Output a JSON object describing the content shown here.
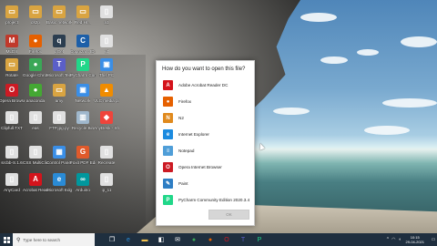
{
  "desktop": {
    "icons": [
      {
        "label": "project",
        "color": "#d9a441",
        "glyph": "▭"
      },
      {
        "label": "ds2p",
        "color": "#d9a441",
        "glyph": "▭"
      },
      {
        "label": "Basic network libr...",
        "color": "#d9a441",
        "glyph": "▭"
      },
      {
        "label": "Red Hr...",
        "color": "#d9a441",
        "glyph": "▭"
      },
      {
        "label": "a1",
        "color": "#e0e0e0",
        "glyph": "▯"
      },
      {
        "label": "MLDS",
        "color": "#c0392b",
        "glyph": "M"
      },
      {
        "label": "Firefox",
        "color": "#e66000",
        "glyph": "●"
      },
      {
        "label": "qGet",
        "color": "#2c3e50",
        "glyph": "q"
      },
      {
        "label": "Cognizant ID & Sign",
        "color": "#1d5fa8",
        "glyph": "C"
      },
      {
        "label": "x4",
        "color": "#e0e0e0",
        "glyph": "▯"
      },
      {
        "label": "Rotate",
        "color": "#d9a441",
        "glyph": "▭"
      },
      {
        "label": "Google Chrome",
        "color": "#3aa757",
        "glyph": "●"
      },
      {
        "label": "Microsoft Teams",
        "color": "#5b5fc7",
        "glyph": "T"
      },
      {
        "label": "PyCharm Community",
        "color": "#21d789",
        "glyph": "P"
      },
      {
        "label": "This PC",
        "color": "#3a8ee6",
        "glyph": "▣"
      },
      {
        "label": "Opera Browser",
        "color": "#cc1b24",
        "glyph": "O"
      },
      {
        "label": "anaconda",
        "color": "#44a833",
        "glyph": "●"
      },
      {
        "label": "amy",
        "color": "#d9a441",
        "glyph": "▭"
      },
      {
        "label": "Network",
        "color": "#3a8ee6",
        "glyph": "▣"
      },
      {
        "label": "VLC media player",
        "color": "#f08c00",
        "glyph": "▲"
      },
      {
        "label": "Clipfull.TXT",
        "color": "#e0e0e0",
        "glyph": "▯"
      },
      {
        "label": "eas",
        "color": "#e0e0e0",
        "glyph": "▯"
      },
      {
        "label": "FTP.jpg.py",
        "color": "#e0e0e0",
        "glyph": "▯"
      },
      {
        "label": "Recycle Bin",
        "color": "#9fb7cc",
        "glyph": "▥"
      },
      {
        "label": "AnyDesk - Shortcut",
        "color": "#ef443b",
        "glyph": "◆"
      },
      {
        "label": "srcbb-S.1.6",
        "color": "#e0e0e0",
        "glyph": "▯"
      },
      {
        "label": "CSS MultiClick",
        "color": "#e0e0e0",
        "glyph": "▯"
      },
      {
        "label": "Control Panel",
        "color": "#3a8ee6",
        "glyph": "▦"
      },
      {
        "label": "Foxit PDF Editor",
        "color": "#e05a2b",
        "glyph": "G"
      },
      {
        "label": "Recreate",
        "color": "#e0e0e0",
        "glyph": "▯"
      },
      {
        "label": "AnyCard",
        "color": "#e0e0e0",
        "glyph": "▯"
      },
      {
        "label": "Acrobat Reader DC",
        "color": "#d4131b",
        "glyph": "A"
      },
      {
        "label": "Microsoft Edge",
        "color": "#2a8bd6",
        "glyph": "e"
      },
      {
        "label": "Arduino",
        "color": "#00979d",
        "glyph": "∞"
      },
      {
        "label": "ip_11",
        "color": "#e0e0e0",
        "glyph": "▯"
      }
    ]
  },
  "dialog": {
    "title": "How do you want to open this file?",
    "apps": [
      {
        "name": "Adobe Acrobat Reader DC",
        "icon": "acrobat-icon",
        "color": "#d4131b",
        "glyph": "A"
      },
      {
        "name": "Firefox",
        "icon": "firefox-icon",
        "color": "#e66000",
        "glyph": "●"
      },
      {
        "name": "N2",
        "icon": "n2-icon",
        "color": "#e08a1e",
        "glyph": "N"
      },
      {
        "name": "Internet Explorer",
        "icon": "internet-explorer-icon",
        "color": "#1c8be0",
        "glyph": "e"
      },
      {
        "name": "Notepad",
        "icon": "notepad-icon",
        "color": "#4f9ed8",
        "glyph": "≡"
      },
      {
        "name": "Opera Internet Browser",
        "icon": "opera-icon",
        "color": "#cc1b24",
        "glyph": "O"
      },
      {
        "name": "Paint",
        "icon": "paint-icon",
        "color": "#2e7ec4",
        "glyph": "✎"
      },
      {
        "name": "PyCharm Community Edition 2020.3.4",
        "icon": "pycharm-icon",
        "color": "#21d789",
        "glyph": "P"
      }
    ],
    "ok_label": "OK"
  },
  "taskbar": {
    "search_placeholder": "Type here to search",
    "pinned": [
      {
        "name": "task-view-icon",
        "color": "#ffffff",
        "glyph": "❐"
      },
      {
        "name": "edge-icon",
        "color": "#2a8bd6",
        "glyph": "e"
      },
      {
        "name": "file-explorer-icon",
        "color": "#f2c14e",
        "glyph": "▬"
      },
      {
        "name": "store-icon",
        "color": "#ffffff",
        "glyph": "◧"
      },
      {
        "name": "mail-icon",
        "color": "#ffffff",
        "glyph": "✉"
      },
      {
        "name": "chrome-icon",
        "color": "#3aa757",
        "glyph": "●"
      },
      {
        "name": "firefox-icon",
        "color": "#e66000",
        "glyph": "●"
      },
      {
        "name": "opera-icon",
        "color": "#cc1b24",
        "glyph": "O"
      },
      {
        "name": "teams-icon",
        "color": "#5b5fc7",
        "glyph": "T"
      },
      {
        "name": "pycharm-icon",
        "color": "#21d789",
        "glyph": "P"
      }
    ],
    "time": "10:15",
    "date": "29-04-2021"
  }
}
